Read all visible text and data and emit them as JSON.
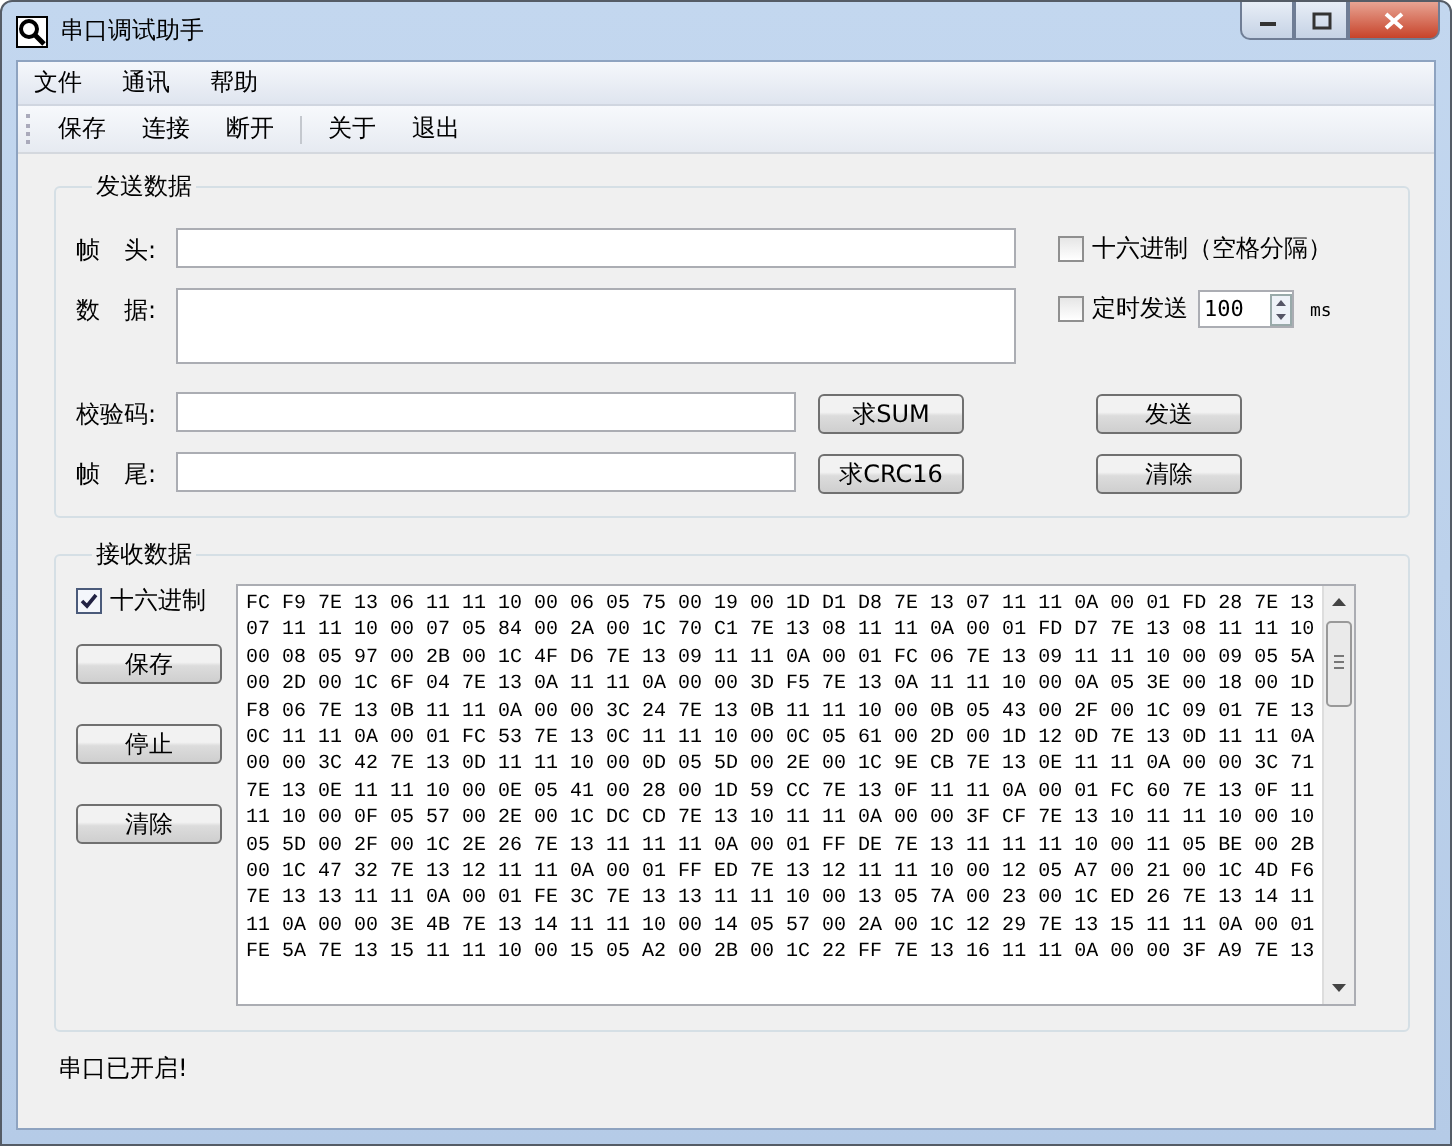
{
  "window": {
    "title": "串口调试助手"
  },
  "menu": [
    "文件",
    "通讯",
    "帮助"
  ],
  "toolbar": {
    "groups": [
      [
        "保存",
        "连接",
        "断开"
      ],
      [
        "关于",
        "退出"
      ]
    ]
  },
  "send": {
    "title": "发送数据",
    "header_label": "帧　头:",
    "data_label": "数　据:",
    "checksum_label": "校验码:",
    "footer_label": "帧　尾:",
    "hex_checkbox": {
      "label": "十六进制（空格分隔）",
      "checked": false
    },
    "timer_checkbox": {
      "label": "定时发送",
      "checked": false
    },
    "interval": "100",
    "interval_unit": "ms",
    "sum_button": "求SUM",
    "crc_button": "求CRC16",
    "send_button": "发送",
    "clear_button": "清除"
  },
  "receive": {
    "title": "接收数据",
    "hex_checkbox": {
      "label": "十六进制",
      "checked": true
    },
    "buttons": [
      "保存",
      "停止",
      "清除"
    ],
    "lines": [
      "FC F9 7E 13 06 11 11 10 00 06 05 75 00 19 00 1D D1 D8 7E 13 07 11 11 0A 00 01 FD 28 7E 13",
      "07 11 11 10 00 07 05 84 00 2A 00 1C 70 C1 7E 13 08 11 11 0A 00 01 FD D7 7E 13 08 11 11 10",
      "00 08 05 97 00 2B 00 1C 4F D6 7E 13 09 11 11 0A 00 01 FC 06 7E 13 09 11 11 10 00 09 05 5A",
      "00 2D 00 1C 6F 04 7E 13 0A 11 11 0A 00 00 3D F5 7E 13 0A 11 11 10 00 0A 05 3E 00 18 00 1D",
      "F8 06 7E 13 0B 11 11 0A 00 00 3C 24 7E 13 0B 11 11 10 00 0B 05 43 00 2F 00 1C 09 01 7E 13",
      "0C 11 11 0A 00 01 FC 53 7E 13 0C 11 11 10 00 0C 05 61 00 2D 00 1D 12 0D 7E 13 0D 11 11 0A",
      "00 00 3C 42 7E 13 0D 11 11 10 00 0D 05 5D 00 2E 00 1C 9E CB 7E 13 0E 11 11 0A 00 00 3C 71",
      "7E 13 0E 11 11 10 00 0E 05 41 00 28 00 1D 59 CC 7E 13 0F 11 11 0A 00 01 FC 60 7E 13 0F 11",
      "11 10 00 0F 05 57 00 2E 00 1C DC CD 7E 13 10 11 11 0A 00 00 3F CF 7E 13 10 11 11 10 00 10",
      "05 5D 00 2F 00 1C 2E 26 7E 13 11 11 11 0A 00 01 FF DE 7E 13 11 11 11 10 00 11 05 BE 00 2B",
      "00 1C 47 32 7E 13 12 11 11 0A 00 01 FF ED 7E 13 12 11 11 10 00 12 05 A7 00 21 00 1C 4D F6",
      "7E 13 13 11 11 0A 00 01 FE 3C 7E 13 13 11 11 10 00 13 05 7A 00 23 00 1C ED 26 7E 13 14 11",
      "11 0A 00 00 3E 4B 7E 13 14 11 11 10 00 14 05 57 00 2A 00 1C 12 29 7E 13 15 11 11 0A 00 01",
      "FE 5A 7E 13 15 11 11 10 00 15 05 A2 00 2B 00 1C 22 FF 7E 13 16 11 11 0A 00 00 3F A9 7E 13"
    ]
  },
  "status_bar": "串口已开启!"
}
